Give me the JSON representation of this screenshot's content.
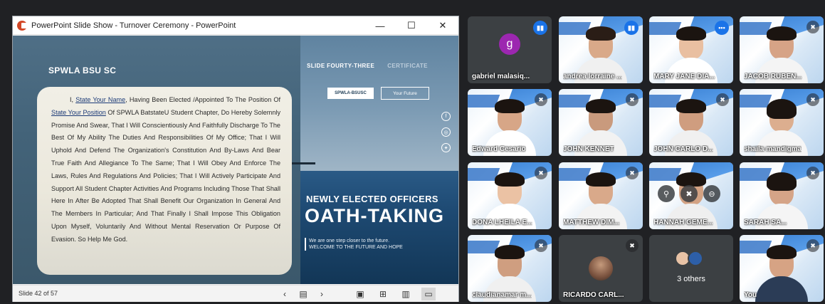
{
  "powerpoint": {
    "window_title": "PowerPoint Slide Show  -  Turnover Ceremony - PowerPoint",
    "controls": {
      "minimize": "—",
      "maximize": "☐",
      "close": "✕"
    },
    "status": {
      "slide_counter": "Slide 42 of 57"
    }
  },
  "slide": {
    "brand": "SPWLA BSU SC",
    "nav": [
      "SLIDE FOURTY-THREE",
      "CERTIFICATE"
    ],
    "chip_primary": "SPWLA-BSUSC",
    "chip_secondary": "Your Future",
    "social_icons": [
      "facebook-icon",
      "instagram-icon",
      "twitter-icon"
    ],
    "oath": {
      "intro": "I, ",
      "placeholder_name": "State Your Name",
      "middle": ", Having Been Elected /Appointed To The Position Of ",
      "placeholder_position": "State Your Position",
      "body": " Of SPWLA BatstateU Student Chapter, Do Hereby Solemnly Promise And Swear, That I Will Conscientiously And Faithfully Discharge To The Best Of My Ability The Duties And Responsibilities Of My Office; That I Will Uphold And Defend The Organization's Constitution And By-Laws And Bear True Faith And Allegiance To The Same; That I Will Obey And Enforce The Laws, Rules And Regulations And Policies; That I Will Actively Participate And Support All Student Chapter Activities And Programs Including Those That Shall Here In After Be Adopted That Shall Benefit Our Organization In General And The Members In Particular; And That Finally I Shall Impose This Obligation Upon Myself, Voluntarily And Without Mental Reservation Or Purpose Of Evasion. So Help Me God."
    },
    "headline_small": "NEWLY ELECTED OFFICERS",
    "headline_large": "OATH-TAKING",
    "sub_line_1": "We are one step closer to the future.",
    "sub_line_2": "WELCOME TO THE FUTURE AND HOPE"
  },
  "participants": [
    {
      "name": "gabriel malasiq...",
      "avatar_letter": "g",
      "avatar_color": "#9c27b0",
      "speaking": true
    },
    {
      "name": "andrea lorraine ...",
      "speaking": true
    },
    {
      "name": "MARY JANE DIA...",
      "more": true
    },
    {
      "name": "JACOB RUBEN...",
      "muted": true
    },
    {
      "name": "Edward Cesario",
      "muted": true
    },
    {
      "name": "JOHN KENNET",
      "muted": true
    },
    {
      "name": "JOHN CARLO D...",
      "muted": true
    },
    {
      "name": "shaila mandigma",
      "muted": true
    },
    {
      "name": "DONA LHEILA E...",
      "muted": true
    },
    {
      "name": "MATTHEW DIM...",
      "muted": true
    },
    {
      "name": "HANNAH GEME...",
      "muted": true
    },
    {
      "name": "SARAH SA...",
      "muted": true
    },
    {
      "name": "claudianamar m...",
      "muted": true
    },
    {
      "name": "RICARDO CARL...",
      "muted": true
    },
    {
      "name": "3 others"
    },
    {
      "name": "You",
      "muted": true
    }
  ]
}
